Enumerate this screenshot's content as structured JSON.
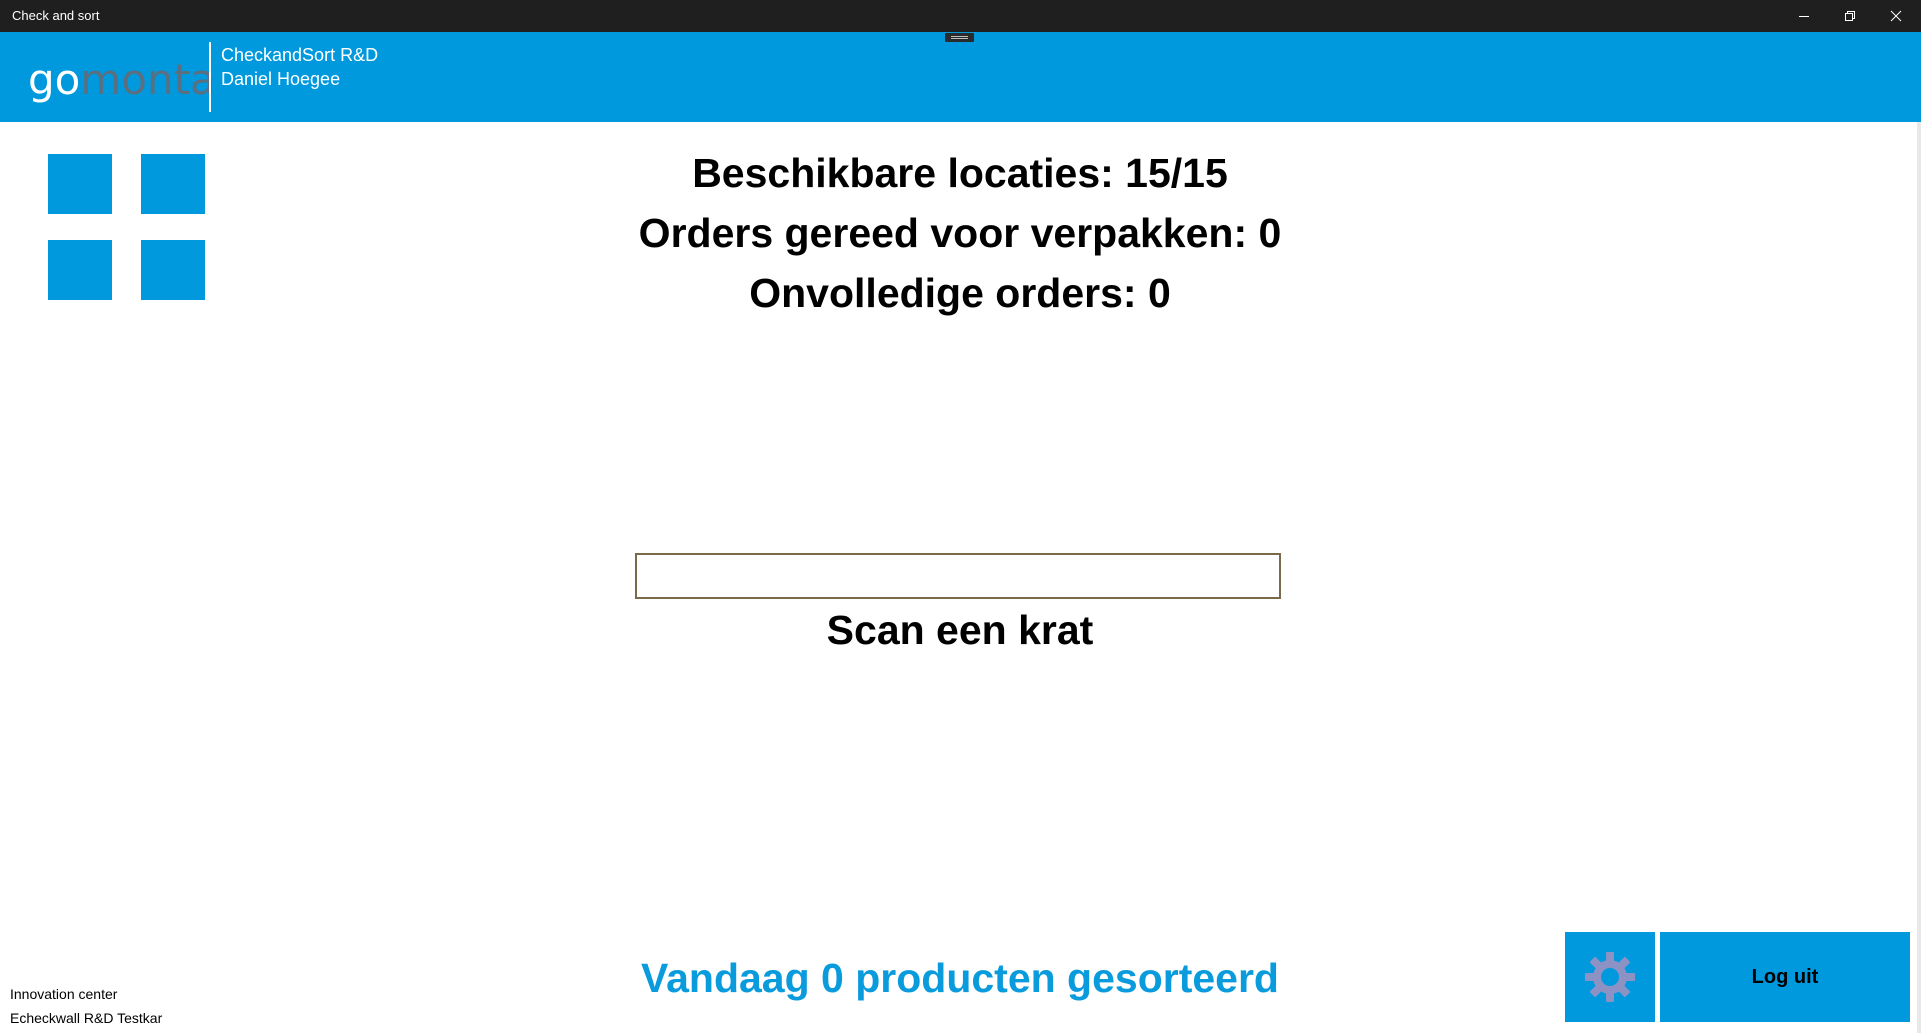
{
  "window": {
    "title": "Check and sort"
  },
  "header": {
    "logo_go": "go",
    "logo_monta": "monta",
    "line1": "CheckandSort R&D",
    "line2": "Daniel Hoegee"
  },
  "stats": {
    "available_locations": "Beschikbare locaties: 15/15",
    "orders_ready": "Orders gereed voor verpakken: 0",
    "incomplete_orders": "Onvolledige orders: 0"
  },
  "scan": {
    "value": "",
    "label": "Scan een krat"
  },
  "footer": {
    "today_sorted": "Vandaag 0 producten gesorteerd",
    "location_line1": "Innovation center",
    "location_line2": "Echeckwall R&D Testkar",
    "logout_label": "Log uit"
  },
  "colors": {
    "accent": "#0099dd",
    "titlebar": "#1f1f1f",
    "gear": "#8c93c4"
  },
  "icons": [
    "minimize-icon",
    "restore-icon",
    "close-icon",
    "grid-menu-icon",
    "gear-icon"
  ]
}
